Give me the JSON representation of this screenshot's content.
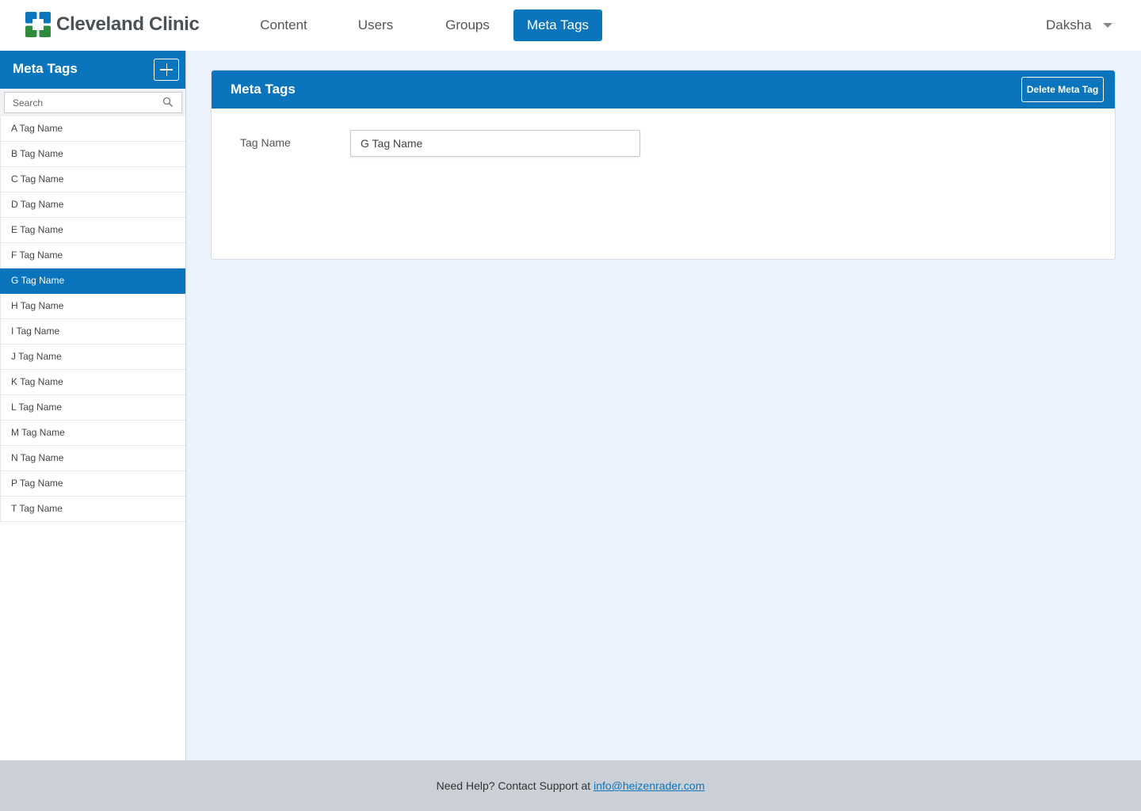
{
  "brand": {
    "name": "Cleveland Clinic",
    "logo_icon": "cleveland-clinic-cross-logo",
    "color_blue": "#0a74bc",
    "color_green": "#2e8b3e"
  },
  "nav": {
    "items": [
      {
        "label": "Content"
      },
      {
        "label": "Users"
      },
      {
        "label": "Groups"
      },
      {
        "label": "Meta Tags",
        "active": true
      }
    ]
  },
  "user_menu": {
    "name": "Daksha",
    "icon": "chevron-down-icon"
  },
  "sidebar": {
    "title": "Meta Tags",
    "add_icon": "plus-icon",
    "search": {
      "placeholder": "Search",
      "value": "",
      "icon": "search-icon"
    },
    "items": [
      {
        "label": "A Tag Name"
      },
      {
        "label": "B Tag Name"
      },
      {
        "label": "C Tag Name"
      },
      {
        "label": "D Tag Name"
      },
      {
        "label": "E Tag Name"
      },
      {
        "label": "F Tag Name"
      },
      {
        "label": "G Tag Name",
        "selected": true
      },
      {
        "label": "H Tag Name"
      },
      {
        "label": "I Tag Name"
      },
      {
        "label": "J Tag Name"
      },
      {
        "label": "K Tag Name"
      },
      {
        "label": "L Tag Name"
      },
      {
        "label": "M Tag Name"
      },
      {
        "label": "N Tag Name"
      },
      {
        "label": "P Tag Name"
      },
      {
        "label": "T Tag Name"
      }
    ]
  },
  "panel": {
    "title": "Meta Tags",
    "delete_label": "Delete Meta Tag",
    "field_label": "Tag Name",
    "field_value": "G Tag Name"
  },
  "footer": {
    "text": "Need Help? Contact Support at",
    "email": "info@heizenrader.com"
  }
}
